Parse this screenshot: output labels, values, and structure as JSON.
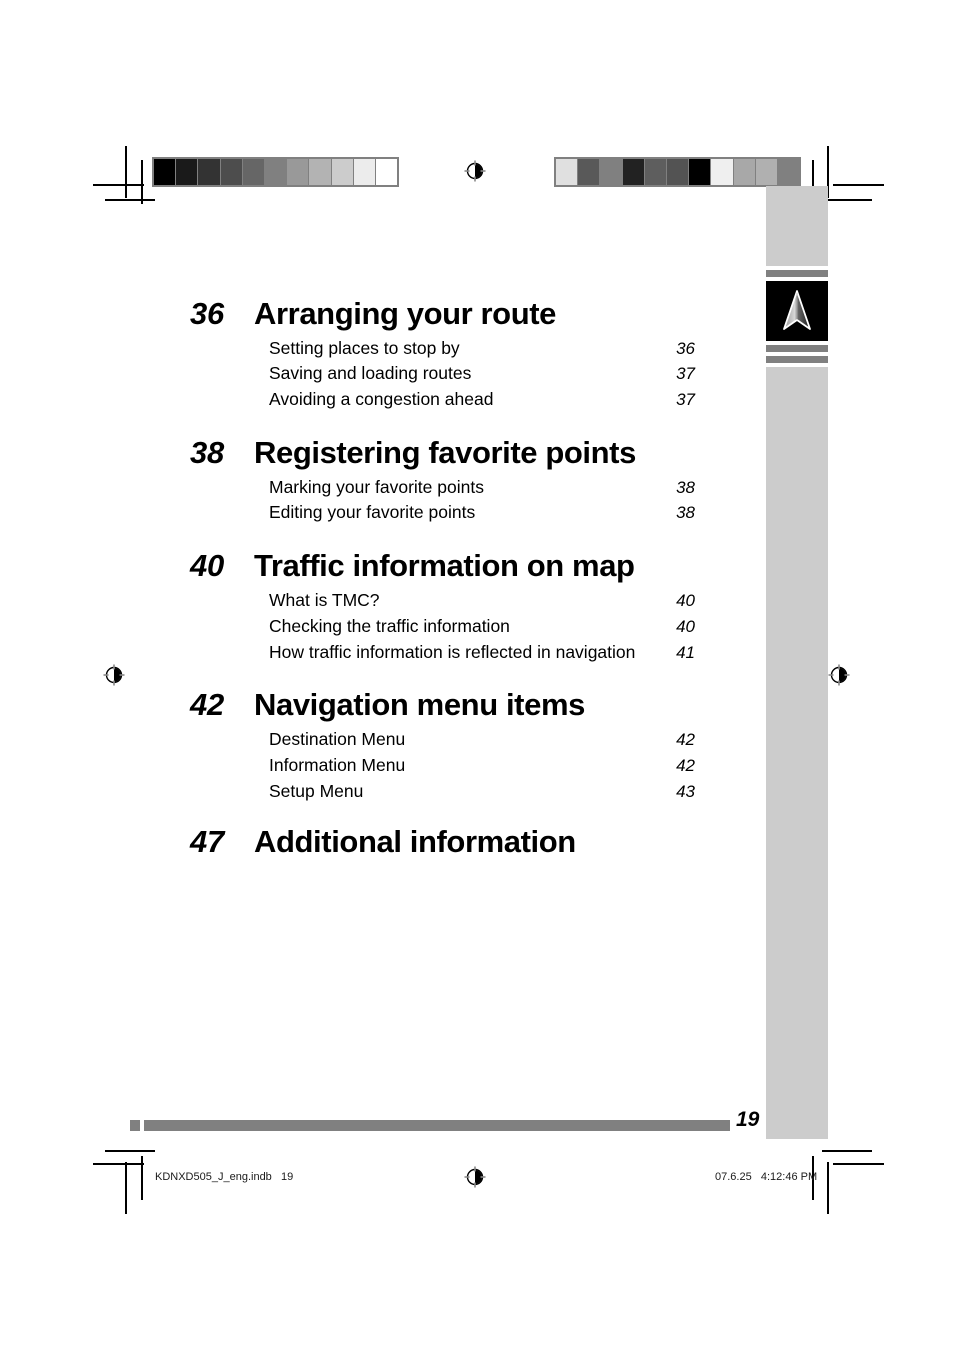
{
  "document": {
    "page_number": "19",
    "footer_file": "KDNXD505_J_eng.indb   19",
    "footer_timestamp": "07.6.25   4:12:46 PM"
  },
  "side_tab": {
    "icon": "navigation-arrow-icon"
  },
  "calibration": {
    "left_bar": [
      "#000000",
      "#1a1a1a",
      "#333333",
      "#4d4d4d",
      "#666666",
      "#808080",
      "#999999",
      "#b3b3b3",
      "#cccccc",
      "#ececec",
      "#ffffff"
    ],
    "right_bar": [
      "#e0e0e0",
      "#595959",
      "#808080",
      "#222222",
      "#5e5e5e",
      "#535353",
      "#000000",
      "#efefef",
      "#a8a8a8",
      "#b0b0b0",
      "#808080"
    ]
  },
  "toc": {
    "sections": [
      {
        "number": "36",
        "title": "Arranging your route",
        "items": [
          {
            "label": "Setting places to stop by",
            "page": "36"
          },
          {
            "label": "Saving and loading routes",
            "page": "37"
          },
          {
            "label": "Avoiding a congestion ahead",
            "page": "37"
          }
        ]
      },
      {
        "number": "38",
        "title": "Registering favorite points",
        "items": [
          {
            "label": "Marking your favorite points",
            "page": "38"
          },
          {
            "label": "Editing your favorite points",
            "page": "38"
          }
        ]
      },
      {
        "number": "40",
        "title": "Traffic information on map",
        "items": [
          {
            "label": "What is TMC?",
            "page": "40"
          },
          {
            "label": "Checking the traffic information",
            "page": "40"
          },
          {
            "label": "How traffic information is reflected in navigation",
            "page": "41"
          }
        ]
      },
      {
        "number": "42",
        "title": "Navigation menu items",
        "items": [
          {
            "label": "Destination Menu",
            "page": "42"
          },
          {
            "label": "Information Menu",
            "page": "42"
          },
          {
            "label": "Setup Menu",
            "page": "43"
          }
        ]
      },
      {
        "number": "47",
        "title": "Additional information",
        "items": []
      }
    ]
  }
}
